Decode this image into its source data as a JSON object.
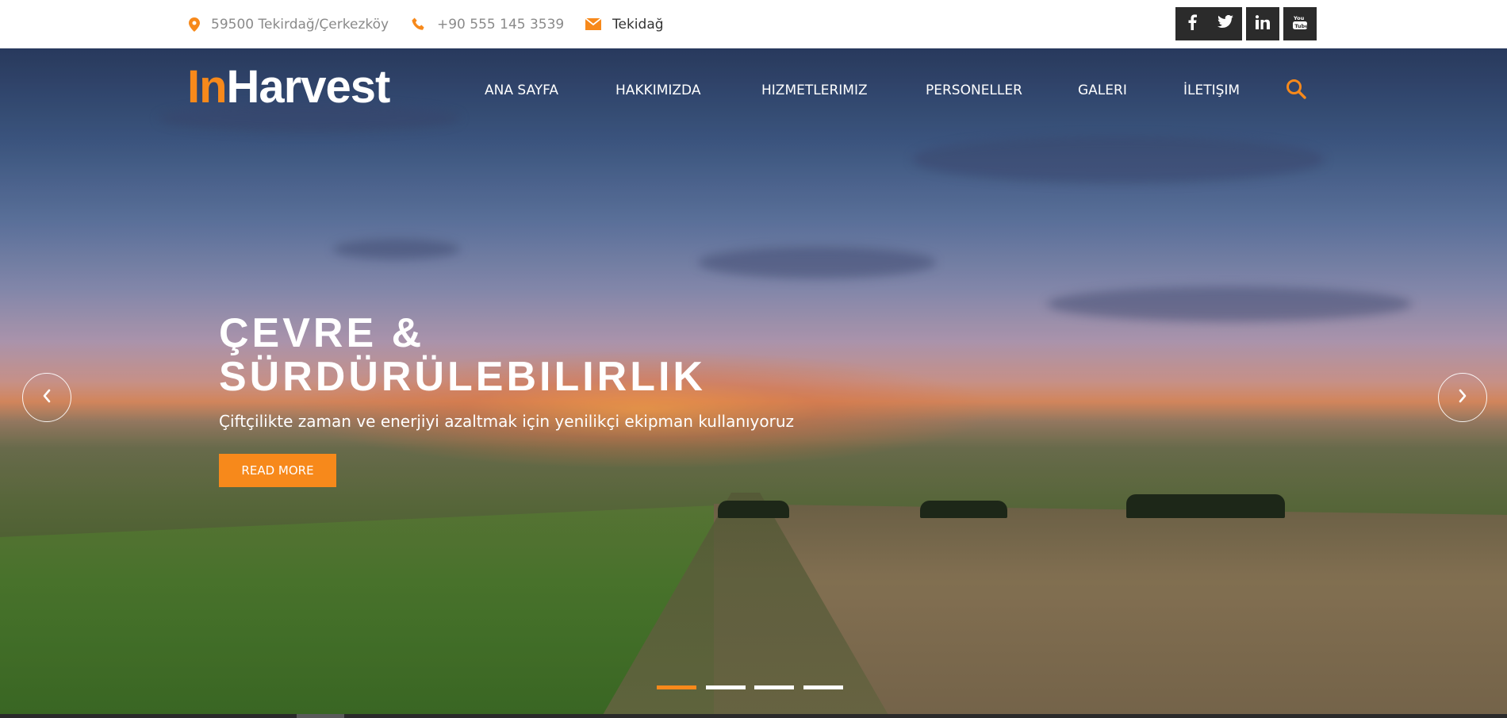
{
  "topbar": {
    "address": "59500 Tekirdağ/Çerkezköy",
    "address_icon": "map-pin-icon",
    "phone": "+90 555 145 3539",
    "phone_icon": "phone-icon",
    "email": "Tekidağ",
    "email_icon": "envelope-icon",
    "social": [
      "facebook-icon",
      "twitter-icon",
      "linkedin-icon",
      "youtube-icon"
    ]
  },
  "brand": {
    "logo_prefix": "In",
    "logo_suffix": "Harvest",
    "accent_color": "#f7891b"
  },
  "nav": {
    "items": [
      "ANA SAYFA",
      "HAKKIMIZDA",
      "HIZMETLERIMIZ",
      "PERSONELLER",
      "GALERI",
      "İLETIŞIM"
    ],
    "search_icon": "search-icon"
  },
  "slider": {
    "title_line1": "ÇEVRE &",
    "title_line2": "SÜRDÜRÜLEBILIRLIK",
    "subtitle": "Çiftçilikte zaman ve enerjiyi azaltmak için yenilikçi ekipman kullanıyoruz",
    "button_label": "READ MORE",
    "prev_icon": "chevron-left-icon",
    "next_icon": "chevron-right-icon",
    "slide_count": 4,
    "active_slide": 1
  }
}
